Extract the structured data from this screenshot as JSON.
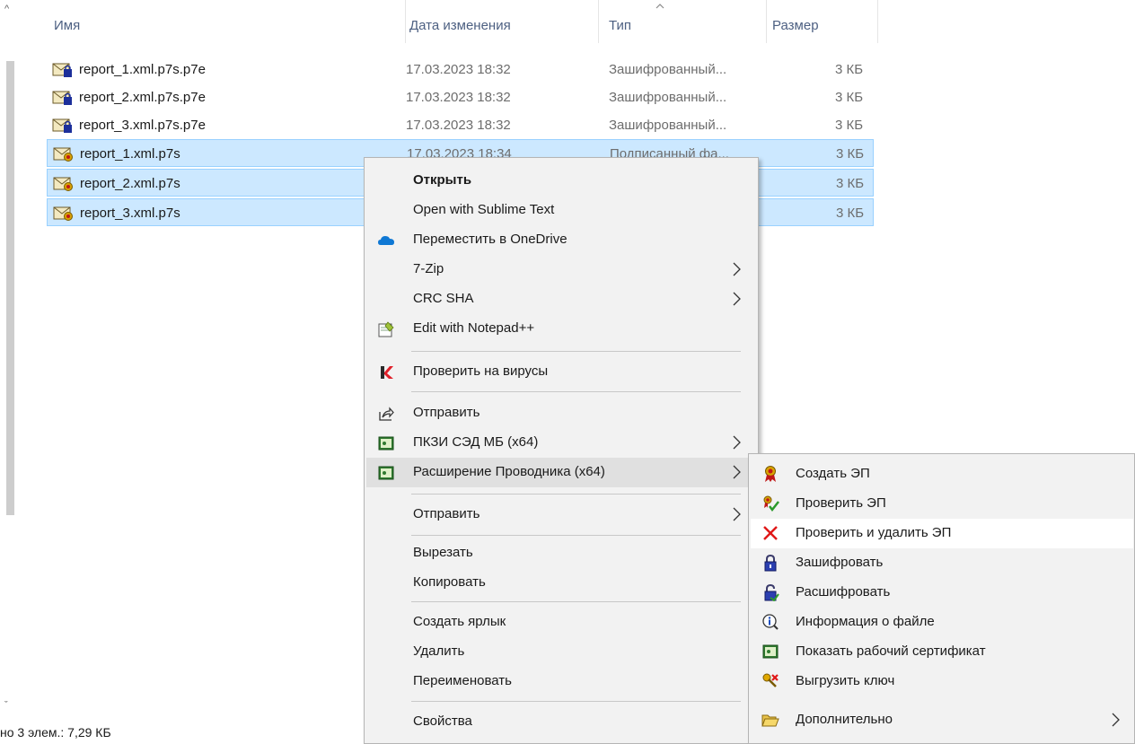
{
  "columns": {
    "name": "Имя",
    "date": "Дата изменения",
    "type": "Тип",
    "size": "Размер"
  },
  "files": [
    {
      "name": "report_1.xml.p7s.p7e",
      "date": "17.03.2023 18:32",
      "type": "Зашифрованный...",
      "size": "3 КБ",
      "icon": "encrypted-mail-icon",
      "selected": false
    },
    {
      "name": "report_2.xml.p7s.p7e",
      "date": "17.03.2023 18:32",
      "type": "Зашифрованный...",
      "size": "3 КБ",
      "icon": "encrypted-mail-icon",
      "selected": false
    },
    {
      "name": "report_3.xml.p7s.p7e",
      "date": "17.03.2023 18:32",
      "type": "Зашифрованный...",
      "size": "3 КБ",
      "icon": "encrypted-mail-icon",
      "selected": false
    },
    {
      "name": "report_1.xml.p7s",
      "date": "17.03.2023 18:34",
      "type": "Подписанный фа...",
      "size": "3 КБ",
      "icon": "signed-mail-icon",
      "selected": true
    },
    {
      "name": "report_2.xml.p7s",
      "date": "",
      "type": "",
      "size": "3 КБ",
      "icon": "signed-mail-icon",
      "selected": true
    },
    {
      "name": "report_3.xml.p7s",
      "date": "",
      "type": "",
      "size": "3 КБ",
      "icon": "signed-mail-icon",
      "selected": true
    }
  ],
  "status_bar": "но 3 элем.: 7,29 КБ",
  "context_menu": {
    "open": "Открыть",
    "open_sublime": "Open with Sublime Text",
    "onedrive": "Переместить в OneDrive",
    "zip": "7-Zip",
    "crc": "CRC SHA",
    "notepad": "Edit with Notepad++",
    "virus": "Проверить на вирусы",
    "share": "Отправить",
    "pkzi": "ПКЗИ СЭД МБ (x64)",
    "explorer_ext": "Расширение Проводника (x64)",
    "send_to": "Отправить",
    "cut": "Вырезать",
    "copy": "Копировать",
    "shortcut": "Создать ярлык",
    "delete": "Удалить",
    "rename": "Переименовать",
    "properties": "Свойства"
  },
  "submenu": {
    "create_sig": "Создать ЭП",
    "verify_sig": "Проверить ЭП",
    "verify_remove_sig": "Проверить и удалить ЭП",
    "encrypt": "Зашифровать",
    "decrypt": "Расшифровать",
    "file_info": "Информация о файле",
    "show_cert": "Показать рабочий сертификат",
    "export_key": "Выгрузить ключ",
    "more": "Дополнительно"
  },
  "colors": {
    "selection": "#cce8ff",
    "selection_border": "#99d1ff",
    "menu_bg": "#f2f2f2",
    "header_text": "#4d6082",
    "onedrive": "#0f78d4",
    "kaspersky": "#e0202a"
  }
}
